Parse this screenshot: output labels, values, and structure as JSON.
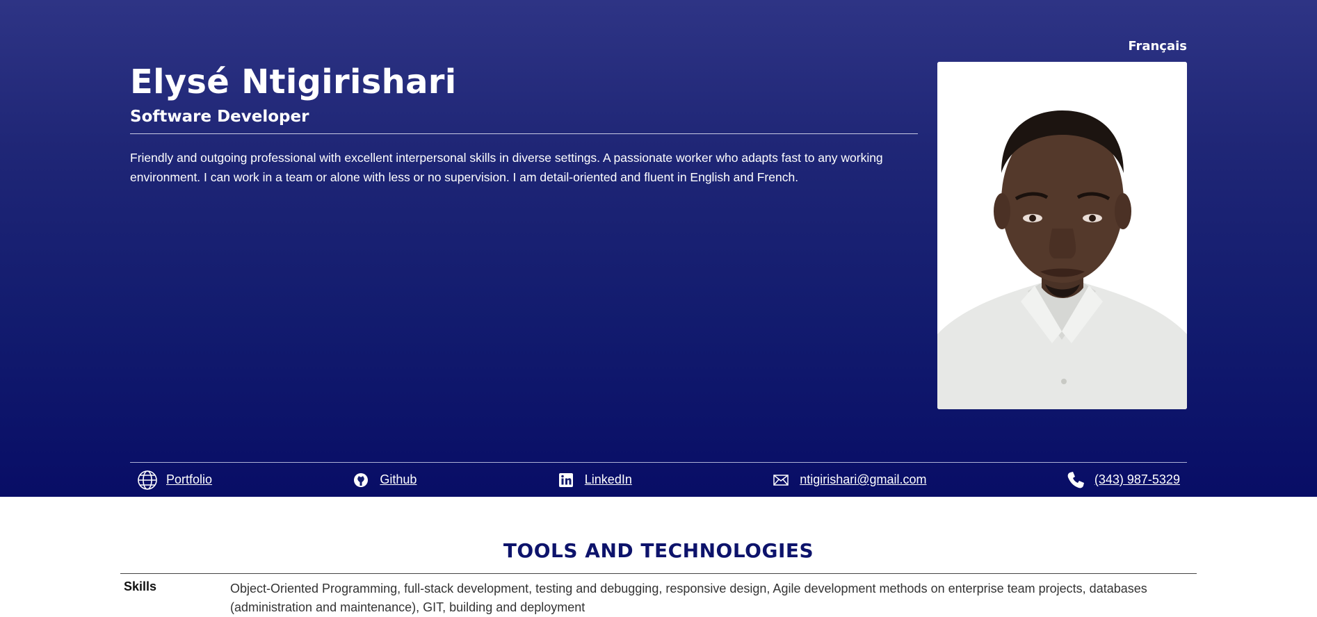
{
  "header": {
    "language_link": "Français",
    "name": "Elysé Ntigirishari",
    "title": "Software Developer",
    "summary": "Friendly and outgoing professional with excellent interpersonal skills in diverse settings. A passionate worker who adapts fast to any working environment. I can work in a team or alone with less or no supervision. I am detail-oriented and fluent in English and French."
  },
  "contacts": [
    {
      "label": "Portfolio",
      "icon": "globe-icon"
    },
    {
      "label": "Github",
      "icon": "github-icon"
    },
    {
      "label": "LinkedIn",
      "icon": "linkedin-icon"
    },
    {
      "label": "ntigirishari@gmail.com",
      "icon": "envelope-icon"
    },
    {
      "label": "(343) 987-5329",
      "icon": "phone-icon"
    }
  ],
  "tools_section": {
    "title": "TOOLS AND TECHNOLOGIES",
    "rows": [
      {
        "label": "Skills",
        "value": "Object-Oriented Programming, full-stack development, testing and debugging, responsive design, Agile development methods on enterprise team projects, databases (administration and maintenance), GIT, building and deployment"
      }
    ]
  },
  "colors": {
    "hero_top": "#2e3485",
    "hero_bottom": "#080d66",
    "section_title": "#0d136b"
  }
}
